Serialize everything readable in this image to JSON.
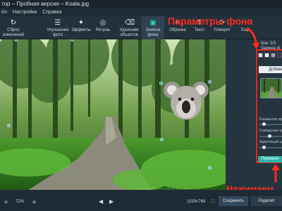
{
  "window": {
    "title": "тор – Пробная версия – Koala.jpg"
  },
  "menu": {
    "items": [
      "йл",
      "Настройки",
      "Справка"
    ]
  },
  "toolbar": {
    "tools": [
      {
        "label1": "Сброс",
        "label2": "изменений",
        "icon": "reset-icon",
        "active": false
      },
      {
        "label1": "Улучшение",
        "label2": "фото",
        "icon": "sliders-icon",
        "active": false
      },
      {
        "label1": "Эффекты",
        "label2": "",
        "icon": "effects-icon",
        "active": false
      },
      {
        "label1": "Ретушь",
        "label2": "",
        "icon": "retouch-icon",
        "active": false
      },
      {
        "label1": "Удаление",
        "label2": "объектов",
        "icon": "eraser-icon",
        "active": false
      },
      {
        "label1": "Замена",
        "label2": "фона",
        "icon": "background-replace-icon",
        "active": true
      },
      {
        "label1": "Обрезка",
        "label2": "",
        "icon": "crop-icon",
        "active": false
      },
      {
        "label1": "Текст",
        "label2": "",
        "icon": "text-icon",
        "active": false
      },
      {
        "label1": "Поворот",
        "label2": "",
        "icon": "rotate-icon",
        "active": false
      },
      {
        "label1": "Ещё",
        "label2": "",
        "icon": "more-icon",
        "active": false
      }
    ]
  },
  "right_panel": {
    "step": "Шаг 3/3",
    "step_sub": "Замена ф",
    "add_button": "Добави",
    "slider1_label": "Размытие кр",
    "slider2_label": "Смещение кра",
    "slider3_label": "Адаптация цв",
    "slider_values": [
      0.15,
      0.45,
      0.15
    ],
    "apply_button": "Примени"
  },
  "callouts": {
    "background_params": "Параметры фона",
    "press": "Нажимаем"
  },
  "bottom_bar": {
    "zoom": "72%",
    "image_size": "1159×768",
    "save_button": "Сохранить",
    "share_button": "Поделит"
  },
  "colors": {
    "accent": "#2ab4a8",
    "callout_red": "#ff2a1c",
    "panel_bg": "#243540"
  }
}
